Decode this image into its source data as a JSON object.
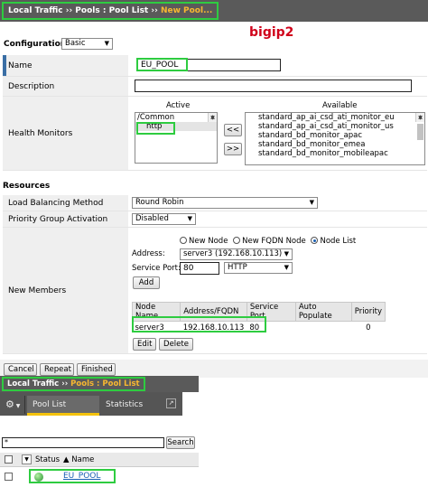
{
  "breadcrumb": {
    "section": "Local Traffic",
    "sep1": "››",
    "path": "Pools : Pool List",
    "sep2": "››",
    "current": "New Pool..."
  },
  "annotation": {
    "device": "bigip2"
  },
  "configuration": {
    "label": "Configuration:",
    "mode": "Basic"
  },
  "general": {
    "name_label": "Name",
    "name_value": "EU_POOL",
    "description_label": "Description",
    "description_value": "",
    "health_monitors_label": "Health Monitors",
    "active_header": "Active",
    "available_header": "Available",
    "active_items": [
      "/Common",
      "http"
    ],
    "available_items": [
      "standard_ap_ai_csd_ati_monitor_eu",
      "standard_ap_ai_csd_ati_monitor_us",
      "standard_bd_monitor_apac",
      "standard_bd_monitor_emea",
      "standard_bd_monitor_mobileapac"
    ],
    "move_left": "<<",
    "move_right": ">>"
  },
  "resources": {
    "heading": "Resources",
    "lb_method_label": "Load Balancing Method",
    "lb_method_value": "Round Robin",
    "priority_label": "Priority Group Activation",
    "priority_value": "Disabled",
    "new_members_label": "New Members",
    "radio_new_node": "New Node",
    "radio_fqdn": "New FQDN Node",
    "radio_node_list": "Node List",
    "address_label": "Address:",
    "address_value": "server3 (192.168.10.113)",
    "port_label": "Service Port:",
    "port_value": "80",
    "port_proto": "HTTP",
    "add_label": "Add",
    "columns": [
      "Node Name",
      "Address/FQDN",
      "Service Port",
      "Auto Populate",
      "Priority"
    ],
    "member": {
      "node": "server3",
      "address": "192.168.10.113",
      "port": "80",
      "auto": "",
      "priority": "0"
    },
    "edit_label": "Edit",
    "delete_label": "Delete"
  },
  "actions": {
    "cancel": "Cancel",
    "repeat": "Repeat",
    "finished": "Finished"
  },
  "bottom": {
    "breadcrumb_section": "Local Traffic",
    "breadcrumb_sep": "››",
    "breadcrumb_path": "Pools : Pool List",
    "tab_pool_list": "Pool List",
    "tab_statistics": "Statistics",
    "search_value": "*",
    "search_button": "Search",
    "col_status": "Status",
    "col_name": "Name",
    "pool_name": "EU_POOL",
    "status_color": "#5cb85c"
  },
  "colors": {
    "highlight": "#2ecc40",
    "breadcrumb_current": "#f7b731",
    "annotation": "#d0021b"
  }
}
